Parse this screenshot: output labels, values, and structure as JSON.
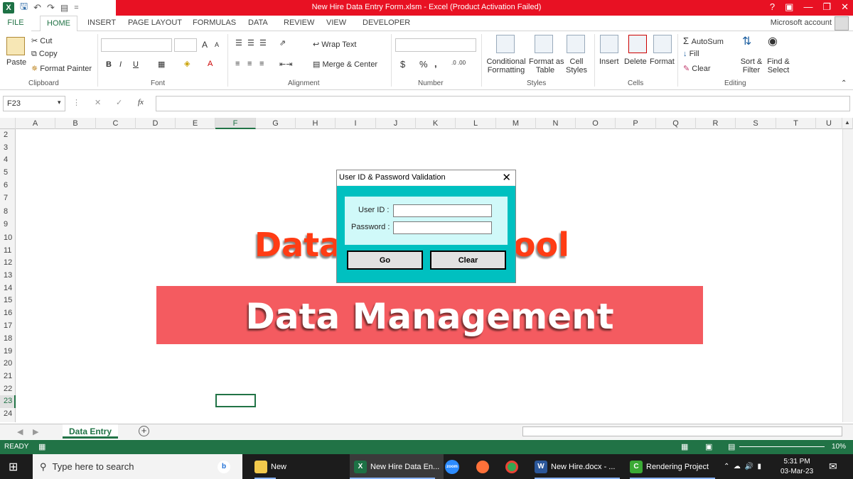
{
  "window": {
    "title": "New Hire Data Entry Form.xlsm  -  Excel (Product Activation Failed)",
    "help": "?",
    "qat_more": "="
  },
  "tabs": {
    "file": "FILE",
    "items": [
      "HOME",
      "INSERT",
      "PAGE LAYOUT",
      "FORMULAS",
      "DATA",
      "REVIEW",
      "VIEW",
      "DEVELOPER"
    ],
    "account": "Microsoft account"
  },
  "ribbon": {
    "clipboard": {
      "paste": "Paste",
      "cut": "Cut",
      "copy": "Copy",
      "format_painter": "Format Painter",
      "label": "Clipboard"
    },
    "font": {
      "label": "Font",
      "bold": "B",
      "italic": "I",
      "underline": "U",
      "grow": "A",
      "shrink": "A",
      "font_color": "A"
    },
    "alignment": {
      "label": "Alignment",
      "wrap": "Wrap Text",
      "merge": "Merge & Center"
    },
    "number": {
      "label": "Number",
      "currency": "$",
      "percent": "%",
      "comma": ",",
      "inc_dec": ".0 .00",
      "dec_dec": ".00 .0"
    },
    "styles": {
      "label": "Styles",
      "cond": "Conditional",
      "cond2": "Formatting",
      "fmt_table": "Format as",
      "fmt_table2": "Table",
      "cell": "Cell",
      "cell2": "Styles"
    },
    "cells": {
      "label": "Cells",
      "insert": "Insert",
      "delete": "Delete",
      "format": "Format"
    },
    "editing": {
      "label": "Editing",
      "autosum": "AutoSum",
      "fill": "Fill",
      "clear": "Clear",
      "sort": "Sort &",
      "sort2": "Filter",
      "find": "Find &",
      "find2": "Select"
    }
  },
  "formula_bar": {
    "name_box": "F23",
    "fx": "fx",
    "cancel": "✕",
    "enter": "✓",
    "value": ""
  },
  "columns": [
    "A",
    "B",
    "C",
    "D",
    "E",
    "F",
    "G",
    "H",
    "I",
    "J",
    "K",
    "L",
    "M",
    "N",
    "O",
    "P",
    "Q",
    "R",
    "S",
    "T",
    "U"
  ],
  "selected_column": "F",
  "rows": [
    "2",
    "3",
    "4",
    "5",
    "6",
    "7",
    "8",
    "9",
    "10",
    "11",
    "12",
    "13",
    "14",
    "15",
    "16",
    "17",
    "18",
    "19",
    "20",
    "21",
    "22",
    "23",
    "24"
  ],
  "selected_row": "23",
  "sheet_graphics": {
    "headline_left": "Data",
    "headline_right": "ool",
    "banner": "Data Management"
  },
  "dialog": {
    "title": "User ID & Password Validation",
    "user_label": "User ID :",
    "password_label": "Password :",
    "user_value": "",
    "password_value": "",
    "go": "Go",
    "clear": "Clear"
  },
  "sheet_tabs": {
    "active": "Data Entry",
    "add": "+"
  },
  "status": {
    "ready": "READY",
    "zoom": "10%"
  },
  "taskbar": {
    "search_placeholder": "Type here to search",
    "apps": [
      "New",
      "New Hire Data En...",
      "zoom",
      "New Hire.docx - ...",
      "Rendering Project"
    ],
    "time": "5:31 PM",
    "date": "03-Mar-23"
  },
  "colors": {
    "excel_green": "#217346",
    "title_red": "#e81123",
    "banner": "#f45b60",
    "headline": "#ff3c14",
    "dialog_body": "#00c0c0",
    "dialog_inner": "#d0f9f9"
  }
}
